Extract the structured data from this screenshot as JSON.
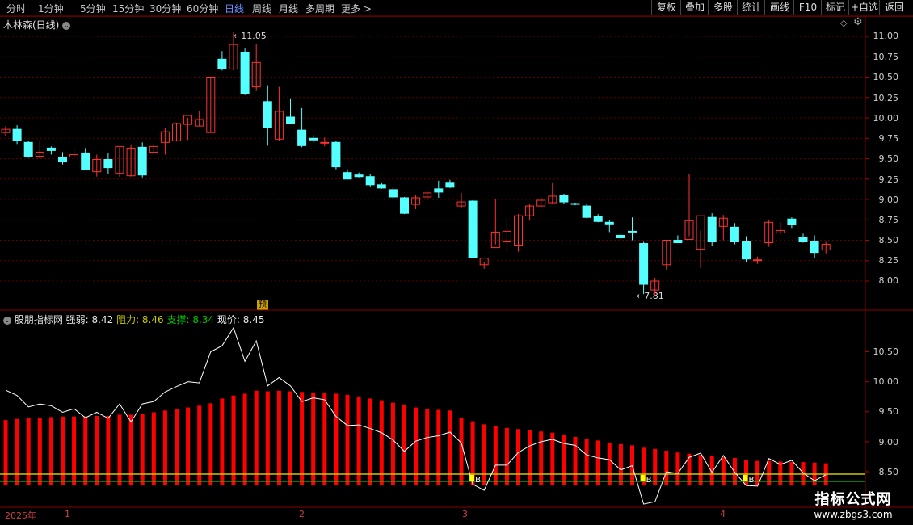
{
  "toolbar": {
    "periods": [
      "分时",
      "1分钟",
      "5分钟",
      "15分钟",
      "30分钟",
      "60分钟",
      "日线",
      "周线",
      "月线",
      "多周期",
      "更多 >"
    ],
    "active_period": "日线",
    "right_buttons": [
      "复权",
      "叠加",
      "多股",
      "统计",
      "画线",
      "F10",
      "标记",
      "+自选",
      "返回"
    ]
  },
  "main_panel": {
    "title": "木林森(日线)",
    "high_label": "11.05",
    "low_label": "7.81",
    "marker": "预",
    "y_ticks": [
      "11.00",
      "10.75",
      "10.50",
      "10.25",
      "10.00",
      "9.75",
      "9.50",
      "9.25",
      "9.00",
      "8.75",
      "8.50",
      "8.25",
      "8.00"
    ]
  },
  "indicator_panel": {
    "name": "股朋指标网",
    "strength_label": "强弱: 8.42",
    "resistance_label": "阻力: 8.46",
    "support_label": "支撑: 8.34",
    "price_label": "现价: 8.45",
    "y_ticks": [
      "10.50",
      "10.00",
      "9.50",
      "9.00",
      "8.50"
    ],
    "signal_text": "B"
  },
  "x_axis": {
    "year": "2025年",
    "months": [
      "1",
      "2",
      "3",
      "4"
    ]
  },
  "watermark": {
    "title": "指标公式网",
    "url": "www.zbgs3.com"
  },
  "colors": {
    "up": "#ff3232",
    "down": "#54ffff",
    "bar": "#ff0000",
    "resist": "#c8c800",
    "support": "#00c800",
    "line": "#ffffff",
    "grid": "#5a0000"
  },
  "chart_data": {
    "type": "candlestick",
    "candles": [
      [
        9.82,
        9.9,
        9.78,
        9.86
      ],
      [
        9.86,
        9.91,
        9.68,
        9.72
      ],
      [
        9.7,
        9.72,
        9.51,
        9.53
      ],
      [
        9.53,
        9.72,
        9.5,
        9.58
      ],
      [
        9.63,
        9.65,
        9.55,
        9.6
      ],
      [
        9.52,
        9.58,
        9.43,
        9.46
      ],
      [
        9.52,
        9.63,
        9.5,
        9.55
      ],
      [
        9.57,
        9.63,
        9.36,
        9.37
      ],
      [
        9.34,
        9.55,
        9.28,
        9.49
      ],
      [
        9.49,
        9.57,
        9.31,
        9.39
      ],
      [
        9.32,
        9.64,
        9.28,
        9.65
      ],
      [
        9.29,
        9.67,
        9.28,
        9.63
      ],
      [
        9.64,
        9.7,
        9.27,
        9.3
      ],
      [
        9.58,
        9.68,
        9.58,
        9.65
      ],
      [
        9.7,
        9.88,
        9.55,
        9.83
      ],
      [
        9.72,
        9.94,
        9.71,
        9.93
      ],
      [
        9.92,
        10.0,
        9.73,
        10.03
      ],
      [
        9.9,
        10.08,
        9.9,
        9.98
      ],
      [
        9.82,
        10.5,
        9.82,
        10.5
      ],
      [
        10.72,
        10.82,
        10.58,
        10.6
      ],
      [
        10.6,
        11.05,
        10.58,
        10.9
      ],
      [
        10.8,
        10.85,
        10.28,
        10.3
      ],
      [
        10.38,
        10.9,
        10.33,
        10.68
      ],
      [
        10.2,
        10.4,
        9.66,
        9.88
      ],
      [
        9.74,
        10.38,
        9.72,
        10.08
      ],
      [
        10.01,
        10.24,
        9.93,
        9.93
      ],
      [
        9.85,
        10.12,
        9.64,
        9.66
      ],
      [
        9.75,
        9.79,
        9.7,
        9.73
      ],
      [
        9.7,
        9.76,
        9.65,
        9.7
      ],
      [
        9.7,
        9.72,
        9.37,
        9.4
      ],
      [
        9.33,
        9.37,
        9.25,
        9.25
      ],
      [
        9.3,
        9.33,
        9.27,
        9.28
      ],
      [
        9.28,
        9.31,
        9.16,
        9.18
      ],
      [
        9.18,
        9.21,
        9.13,
        9.14
      ],
      [
        9.12,
        9.15,
        9.0,
        9.03
      ],
      [
        9.02,
        9.03,
        8.82,
        8.83
      ],
      [
        8.94,
        9.05,
        8.88,
        9.02
      ],
      [
        9.03,
        9.1,
        8.99,
        9.08
      ],
      [
        9.13,
        9.23,
        9.02,
        9.09
      ],
      [
        9.21,
        9.24,
        9.14,
        9.15
      ],
      [
        8.92,
        9.08,
        8.9,
        8.97
      ],
      [
        8.98,
        8.99,
        8.28,
        8.29
      ],
      [
        8.2,
        8.23,
        8.15,
        8.28
      ],
      [
        8.41,
        9.0,
        8.45,
        8.6
      ],
      [
        8.48,
        8.76,
        8.36,
        8.61
      ],
      [
        8.44,
        8.82,
        8.36,
        8.8
      ],
      [
        8.8,
        8.94,
        8.74,
        8.92
      ],
      [
        8.92,
        9.03,
        8.91,
        8.99
      ],
      [
        8.96,
        9.21,
        8.94,
        9.04
      ],
      [
        9.05,
        9.07,
        8.95,
        8.97
      ],
      [
        8.95,
        8.96,
        8.93,
        8.94
      ],
      [
        8.92,
        8.94,
        8.77,
        8.78
      ],
      [
        8.79,
        8.82,
        8.72,
        8.73
      ],
      [
        8.72,
        8.75,
        8.6,
        8.7
      ],
      [
        8.56,
        8.58,
        8.5,
        8.53
      ],
      [
        8.61,
        8.78,
        8.5,
        8.6
      ],
      [
        8.46,
        8.48,
        7.84,
        7.96
      ],
      [
        7.89,
        8.04,
        7.81,
        8.0
      ],
      [
        8.2,
        8.5,
        8.14,
        8.5
      ],
      [
        8.5,
        8.56,
        8.48,
        8.47
      ],
      [
        8.51,
        9.31,
        8.55,
        8.74
      ],
      [
        8.39,
        8.62,
        8.16,
        8.8
      ],
      [
        8.78,
        8.83,
        8.43,
        8.48
      ],
      [
        8.67,
        8.81,
        8.5,
        8.77
      ],
      [
        8.66,
        8.71,
        8.45,
        8.48
      ],
      [
        8.48,
        8.55,
        8.23,
        8.27
      ],
      [
        8.25,
        8.3,
        8.21,
        8.26
      ],
      [
        8.47,
        8.75,
        8.42,
        8.72
      ],
      [
        8.59,
        8.72,
        8.57,
        8.62
      ],
      [
        8.76,
        8.78,
        8.65,
        8.69
      ],
      [
        8.53,
        8.58,
        8.47,
        8.48
      ],
      [
        8.49,
        8.56,
        8.28,
        8.35
      ],
      [
        8.38,
        8.48,
        8.34,
        8.45
      ]
    ],
    "strength_bars": [
      9.36,
      9.38,
      9.39,
      9.4,
      9.41,
      9.42,
      9.42,
      9.42,
      9.43,
      9.43,
      9.45,
      9.45,
      9.46,
      9.49,
      9.52,
      9.54,
      9.57,
      9.6,
      9.64,
      9.72,
      9.77,
      9.8,
      9.85,
      9.84,
      9.85,
      9.84,
      9.83,
      9.82,
      9.81,
      9.8,
      9.78,
      9.75,
      9.72,
      9.69,
      9.65,
      9.62,
      9.57,
      9.55,
      9.53,
      9.52,
      9.39,
      9.34,
      9.29,
      9.26,
      9.23,
      9.21,
      9.19,
      9.17,
      9.15,
      9.12,
      9.08,
      9.05,
      9.02,
      8.98,
      8.96,
      8.94,
      8.9,
      8.88,
      8.85,
      8.82,
      8.8,
      8.78,
      8.76,
      8.74,
      8.73,
      8.7,
      8.68,
      8.68,
      8.67,
      8.66,
      8.66,
      8.65,
      8.64
    ],
    "price_line": [
      9.86,
      9.77,
      9.58,
      9.63,
      9.6,
      9.49,
      9.55,
      9.4,
      9.49,
      9.39,
      9.63,
      9.33,
      9.63,
      9.67,
      9.83,
      9.92,
      10.0,
      9.98,
      10.5,
      10.6,
      10.9,
      10.34,
      10.68,
      9.93,
      10.07,
      9.93,
      9.67,
      9.73,
      9.7,
      9.42,
      9.27,
      9.28,
      9.22,
      9.15,
      9.03,
      8.84,
      9.01,
      9.07,
      9.1,
      9.16,
      8.98,
      8.29,
      8.19,
      8.61,
      8.61,
      8.82,
      8.93,
      9.0,
      9.04,
      8.97,
      8.94,
      8.78,
      8.73,
      8.7,
      8.53,
      8.6,
      7.96,
      8.0,
      8.5,
      8.47,
      8.74,
      8.81,
      8.49,
      8.77,
      8.49,
      8.27,
      8.26,
      8.72,
      8.62,
      8.69,
      8.48,
      8.35,
      8.45
    ],
    "resistance": 8.46,
    "support": 8.34,
    "buy_signals": [
      41,
      56,
      65
    ]
  }
}
